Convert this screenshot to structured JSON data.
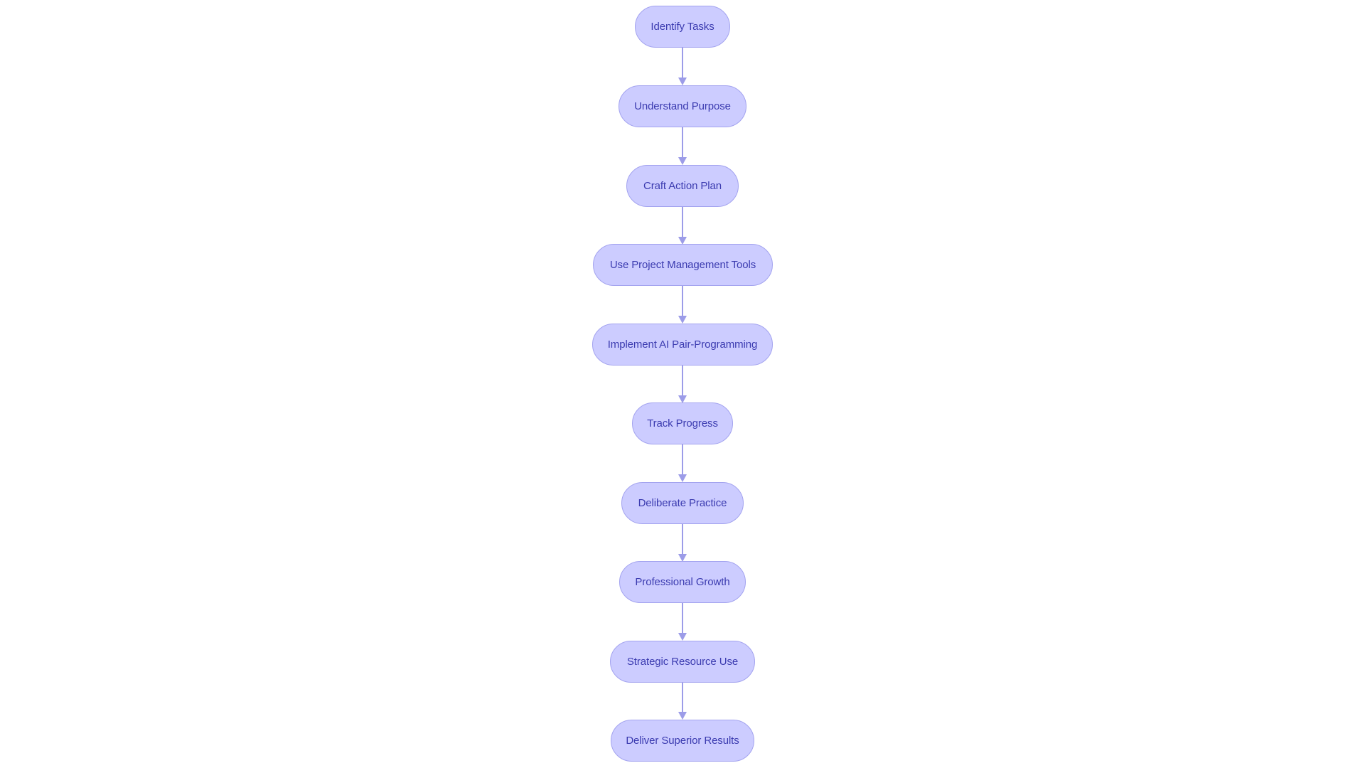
{
  "diagram": {
    "type": "flowchart",
    "direction": "top-to-bottom",
    "colors": {
      "node_fill": "#ccccff",
      "node_stroke": "#a3a3ef",
      "node_text": "#3b3bb0",
      "edge": "#9c9ce8",
      "background": "#ffffff"
    },
    "nodes": [
      {
        "id": "n1",
        "label": "Identify Tasks"
      },
      {
        "id": "n2",
        "label": "Understand Purpose"
      },
      {
        "id": "n3",
        "label": "Craft Action Plan"
      },
      {
        "id": "n4",
        "label": "Use Project Management Tools"
      },
      {
        "id": "n5",
        "label": "Implement AI Pair-Programming"
      },
      {
        "id": "n6",
        "label": "Track Progress"
      },
      {
        "id": "n7",
        "label": "Deliberate Practice"
      },
      {
        "id": "n8",
        "label": "Professional Growth"
      },
      {
        "id": "n9",
        "label": "Strategic Resource Use"
      },
      {
        "id": "n10",
        "label": "Deliver Superior Results"
      }
    ],
    "edges": [
      {
        "from": "n1",
        "to": "n2"
      },
      {
        "from": "n2",
        "to": "n3"
      },
      {
        "from": "n3",
        "to": "n4"
      },
      {
        "from": "n4",
        "to": "n5"
      },
      {
        "from": "n5",
        "to": "n6"
      },
      {
        "from": "n6",
        "to": "n7"
      },
      {
        "from": "n7",
        "to": "n8"
      },
      {
        "from": "n8",
        "to": "n9"
      },
      {
        "from": "n9",
        "to": "n10"
      }
    ]
  }
}
